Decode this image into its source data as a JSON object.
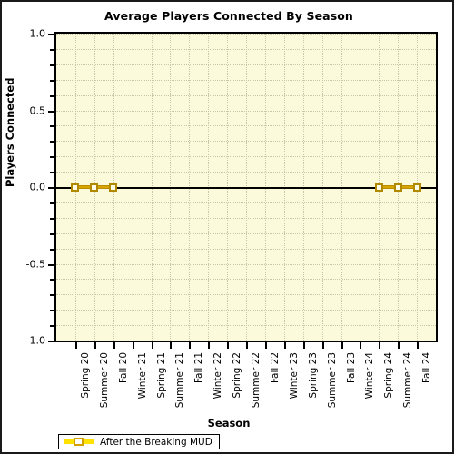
{
  "chart_data": {
    "type": "line",
    "title": "Average Players Connected By Season",
    "xlabel": "Season",
    "ylabel": "Players Connected",
    "ylim": [
      -1.0,
      1.0
    ],
    "yticks": [
      "-1.0",
      "-0.5",
      "0.0",
      "0.5",
      "1.0"
    ],
    "ytick_values": [
      -1.0,
      -0.5,
      0.0,
      0.5,
      1.0
    ],
    "grid": true,
    "legend_position": "bottom-left",
    "categories": [
      "Spring 20",
      "Summer 20",
      "Fall 20",
      "Winter 21",
      "Spring 21",
      "Summer 21",
      "Fall 21",
      "Winter 22",
      "Spring 22",
      "Summer 22",
      "Fall 22",
      "Winter 23",
      "Spring 23",
      "Summer 23",
      "Fall 23",
      "Winter 24",
      "Spring 24",
      "Summer 24",
      "Fall 24"
    ],
    "series": [
      {
        "name": "After the Breaking MUD",
        "color": "#ffe200",
        "marker_color": "#b08900",
        "values": [
          0,
          0,
          0,
          null,
          null,
          null,
          null,
          null,
          null,
          null,
          null,
          null,
          null,
          null,
          null,
          null,
          0,
          0,
          0
        ]
      }
    ]
  },
  "legend": {
    "entries": [
      {
        "label": "After the Breaking MUD"
      }
    ]
  }
}
